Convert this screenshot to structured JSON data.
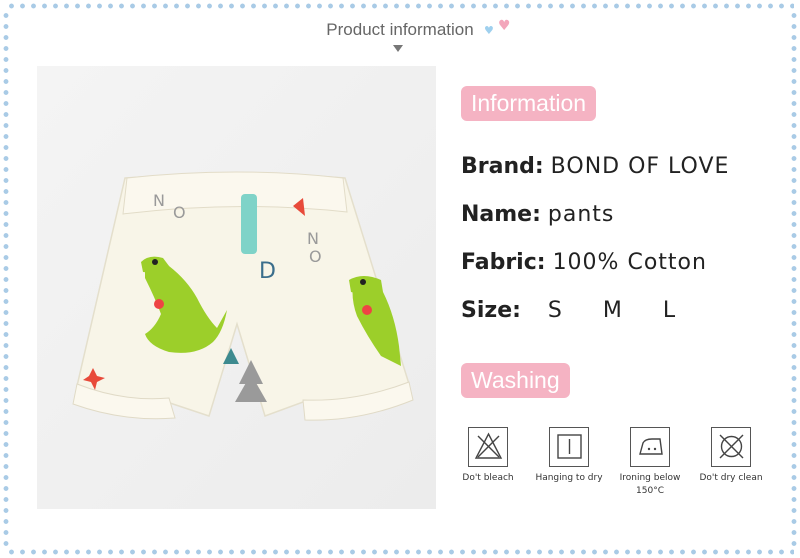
{
  "header": {
    "title": "Product information"
  },
  "info_pill": "Information",
  "info": {
    "brand_label": "Brand:",
    "brand_value": "BOND OF LOVE",
    "name_label": "Name:",
    "name_value": "pants",
    "fabric_label": "Fabric:",
    "fabric_value": "100% Cotton",
    "size_label": "Size:",
    "sizes": [
      "S",
      "M",
      "L"
    ]
  },
  "washing_pill": "Washing",
  "washing": [
    {
      "icon": "no-bleach-icon",
      "caption": "Do't bleach"
    },
    {
      "icon": "hang-dry-icon",
      "caption": "Hanging to dry"
    },
    {
      "icon": "iron-icon",
      "caption": "Ironing below 150°C"
    },
    {
      "icon": "no-dry-clean-icon",
      "caption": "Do't dry clean"
    }
  ],
  "colors": {
    "pill": "#f5b3c3",
    "dots": "#a9cbe6",
    "crocodile": "#9ccf2a"
  }
}
